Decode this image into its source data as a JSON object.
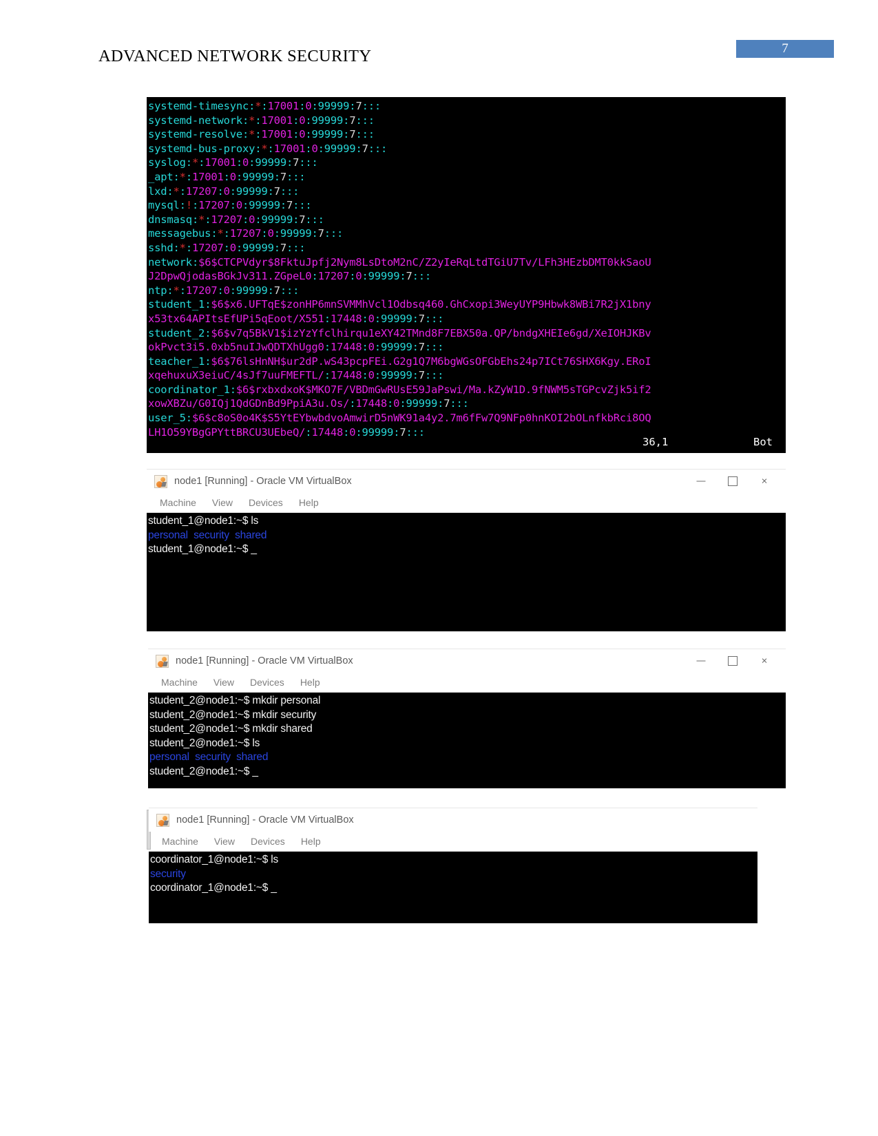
{
  "document": {
    "header_title": "ADVANCED NETWORK SECURITY",
    "page_number": "7",
    "accent_color": "#4f81bd"
  },
  "shadow_terminal": {
    "name": "etc-shadow-dump",
    "status_position": "36,1",
    "status_mode": "Bot",
    "lines": [
      [
        {
          "t": "systemd-timesync",
          "c": "cyan"
        },
        {
          "t": ":",
          "c": "cyan"
        },
        {
          "t": "*",
          "c": "red"
        },
        {
          "t": ":",
          "c": "cyan"
        },
        {
          "t": "17001",
          "c": "mag"
        },
        {
          "t": ":",
          "c": "cyan"
        },
        {
          "t": "0",
          "c": "mag"
        },
        {
          "t": ":",
          "c": "cyan"
        },
        {
          "t": "99999",
          "c": "cyan"
        },
        {
          "t": ":",
          "c": "cyan"
        },
        {
          "t": "7",
          "c": "white"
        },
        {
          "t": ":::",
          "c": "cyan"
        }
      ],
      [
        {
          "t": "systemd-network",
          "c": "cyan"
        },
        {
          "t": ":",
          "c": "cyan"
        },
        {
          "t": "*",
          "c": "red"
        },
        {
          "t": ":",
          "c": "cyan"
        },
        {
          "t": "17001",
          "c": "mag"
        },
        {
          "t": ":",
          "c": "cyan"
        },
        {
          "t": "0",
          "c": "mag"
        },
        {
          "t": ":",
          "c": "cyan"
        },
        {
          "t": "99999",
          "c": "cyan"
        },
        {
          "t": ":",
          "c": "cyan"
        },
        {
          "t": "7",
          "c": "white"
        },
        {
          "t": ":::",
          "c": "cyan"
        }
      ],
      [
        {
          "t": "systemd-resolve",
          "c": "cyan"
        },
        {
          "t": ":",
          "c": "cyan"
        },
        {
          "t": "*",
          "c": "red"
        },
        {
          "t": ":",
          "c": "cyan"
        },
        {
          "t": "17001",
          "c": "mag"
        },
        {
          "t": ":",
          "c": "cyan"
        },
        {
          "t": "0",
          "c": "mag"
        },
        {
          "t": ":",
          "c": "cyan"
        },
        {
          "t": "99999",
          "c": "cyan"
        },
        {
          "t": ":",
          "c": "cyan"
        },
        {
          "t": "7",
          "c": "white"
        },
        {
          "t": ":::",
          "c": "cyan"
        }
      ],
      [
        {
          "t": "systemd-bus-proxy",
          "c": "cyan"
        },
        {
          "t": ":",
          "c": "cyan"
        },
        {
          "t": "*",
          "c": "red"
        },
        {
          "t": ":",
          "c": "cyan"
        },
        {
          "t": "17001",
          "c": "mag"
        },
        {
          "t": ":",
          "c": "cyan"
        },
        {
          "t": "0",
          "c": "mag"
        },
        {
          "t": ":",
          "c": "cyan"
        },
        {
          "t": "99999",
          "c": "cyan"
        },
        {
          "t": ":",
          "c": "cyan"
        },
        {
          "t": "7",
          "c": "white"
        },
        {
          "t": ":::",
          "c": "cyan"
        }
      ],
      [
        {
          "t": "syslog",
          "c": "cyan"
        },
        {
          "t": ":",
          "c": "cyan"
        },
        {
          "t": "*",
          "c": "red"
        },
        {
          "t": ":",
          "c": "cyan"
        },
        {
          "t": "17001",
          "c": "mag"
        },
        {
          "t": ":",
          "c": "cyan"
        },
        {
          "t": "0",
          "c": "mag"
        },
        {
          "t": ":",
          "c": "cyan"
        },
        {
          "t": "99999",
          "c": "cyan"
        },
        {
          "t": ":",
          "c": "cyan"
        },
        {
          "t": "7",
          "c": "white"
        },
        {
          "t": ":::",
          "c": "cyan"
        }
      ],
      [
        {
          "t": "_apt",
          "c": "cyan"
        },
        {
          "t": ":",
          "c": "cyan"
        },
        {
          "t": "*",
          "c": "red"
        },
        {
          "t": ":",
          "c": "cyan"
        },
        {
          "t": "17001",
          "c": "mag"
        },
        {
          "t": ":",
          "c": "cyan"
        },
        {
          "t": "0",
          "c": "mag"
        },
        {
          "t": ":",
          "c": "cyan"
        },
        {
          "t": "99999",
          "c": "cyan"
        },
        {
          "t": ":",
          "c": "cyan"
        },
        {
          "t": "7",
          "c": "white"
        },
        {
          "t": ":::",
          "c": "cyan"
        }
      ],
      [
        {
          "t": "lxd",
          "c": "cyan"
        },
        {
          "t": ":",
          "c": "cyan"
        },
        {
          "t": "*",
          "c": "red"
        },
        {
          "t": ":",
          "c": "cyan"
        },
        {
          "t": "17207",
          "c": "mag"
        },
        {
          "t": ":",
          "c": "cyan"
        },
        {
          "t": "0",
          "c": "mag"
        },
        {
          "t": ":",
          "c": "cyan"
        },
        {
          "t": "99999",
          "c": "cyan"
        },
        {
          "t": ":",
          "c": "cyan"
        },
        {
          "t": "7",
          "c": "white"
        },
        {
          "t": ":::",
          "c": "cyan"
        }
      ],
      [
        {
          "t": "mysql",
          "c": "cyan"
        },
        {
          "t": ":",
          "c": "cyan"
        },
        {
          "t": "!",
          "c": "red"
        },
        {
          "t": ":",
          "c": "cyan"
        },
        {
          "t": "17207",
          "c": "mag"
        },
        {
          "t": ":",
          "c": "cyan"
        },
        {
          "t": "0",
          "c": "mag"
        },
        {
          "t": ":",
          "c": "cyan"
        },
        {
          "t": "99999",
          "c": "cyan"
        },
        {
          "t": ":",
          "c": "cyan"
        },
        {
          "t": "7",
          "c": "white"
        },
        {
          "t": ":::",
          "c": "cyan"
        }
      ],
      [
        {
          "t": "dnsmasq",
          "c": "cyan"
        },
        {
          "t": ":",
          "c": "cyan"
        },
        {
          "t": "*",
          "c": "red"
        },
        {
          "t": ":",
          "c": "cyan"
        },
        {
          "t": "17207",
          "c": "mag"
        },
        {
          "t": ":",
          "c": "cyan"
        },
        {
          "t": "0",
          "c": "mag"
        },
        {
          "t": ":",
          "c": "cyan"
        },
        {
          "t": "99999",
          "c": "cyan"
        },
        {
          "t": ":",
          "c": "cyan"
        },
        {
          "t": "7",
          "c": "white"
        },
        {
          "t": ":::",
          "c": "cyan"
        }
      ],
      [
        {
          "t": "messagebus",
          "c": "cyan"
        },
        {
          "t": ":",
          "c": "cyan"
        },
        {
          "t": "*",
          "c": "red"
        },
        {
          "t": ":",
          "c": "cyan"
        },
        {
          "t": "17207",
          "c": "mag"
        },
        {
          "t": ":",
          "c": "cyan"
        },
        {
          "t": "0",
          "c": "mag"
        },
        {
          "t": ":",
          "c": "cyan"
        },
        {
          "t": "99999",
          "c": "cyan"
        },
        {
          "t": ":",
          "c": "cyan"
        },
        {
          "t": "7",
          "c": "white"
        },
        {
          "t": ":::",
          "c": "cyan"
        }
      ],
      [
        {
          "t": "sshd",
          "c": "cyan"
        },
        {
          "t": ":",
          "c": "cyan"
        },
        {
          "t": "*",
          "c": "red"
        },
        {
          "t": ":",
          "c": "cyan"
        },
        {
          "t": "17207",
          "c": "mag"
        },
        {
          "t": ":",
          "c": "cyan"
        },
        {
          "t": "0",
          "c": "mag"
        },
        {
          "t": ":",
          "c": "cyan"
        },
        {
          "t": "99999",
          "c": "cyan"
        },
        {
          "t": ":",
          "c": "cyan"
        },
        {
          "t": "7",
          "c": "white"
        },
        {
          "t": ":::",
          "c": "cyan"
        }
      ],
      [
        {
          "t": "network",
          "c": "cyan"
        },
        {
          "t": ":",
          "c": "cyan"
        },
        {
          "t": "$6$CTCPVdyr$8FktuJpfj2Nym8LsDtoM2nC/Z2yIeRqLtdTGiU7Tv/LFh3HEzbDMT0kkSaoU",
          "c": "mag"
        }
      ],
      [
        {
          "t": "J2DpwQjodasBGkJv311.ZGpeL0",
          "c": "mag"
        },
        {
          "t": ":",
          "c": "cyan"
        },
        {
          "t": "17207",
          "c": "mag"
        },
        {
          "t": ":",
          "c": "cyan"
        },
        {
          "t": "0",
          "c": "mag"
        },
        {
          "t": ":",
          "c": "cyan"
        },
        {
          "t": "99999",
          "c": "cyan"
        },
        {
          "t": ":",
          "c": "cyan"
        },
        {
          "t": "7",
          "c": "white"
        },
        {
          "t": ":::",
          "c": "cyan"
        }
      ],
      [
        {
          "t": "ntp",
          "c": "cyan"
        },
        {
          "t": ":",
          "c": "cyan"
        },
        {
          "t": "*",
          "c": "red"
        },
        {
          "t": ":",
          "c": "cyan"
        },
        {
          "t": "17207",
          "c": "mag"
        },
        {
          "t": ":",
          "c": "cyan"
        },
        {
          "t": "0",
          "c": "mag"
        },
        {
          "t": ":",
          "c": "cyan"
        },
        {
          "t": "99999",
          "c": "cyan"
        },
        {
          "t": ":",
          "c": "cyan"
        },
        {
          "t": "7",
          "c": "white"
        },
        {
          "t": ":::",
          "c": "cyan"
        }
      ],
      [
        {
          "t": "student_1",
          "c": "cyan"
        },
        {
          "t": ":",
          "c": "cyan"
        },
        {
          "t": "$6$x6.UFTqE$zonHP6mnSVMMhVcl1Odbsq460.GhCxopi3WeyUYP9Hbwk8WBi7R2jX1bny",
          "c": "mag"
        }
      ],
      [
        {
          "t": "x53tx64APItsEfUPi5qEoot/X551",
          "c": "mag"
        },
        {
          "t": ":",
          "c": "cyan"
        },
        {
          "t": "17448",
          "c": "mag"
        },
        {
          "t": ":",
          "c": "cyan"
        },
        {
          "t": "0",
          "c": "mag"
        },
        {
          "t": ":",
          "c": "cyan"
        },
        {
          "t": "99999",
          "c": "cyan"
        },
        {
          "t": ":",
          "c": "cyan"
        },
        {
          "t": "7",
          "c": "white"
        },
        {
          "t": ":::",
          "c": "cyan"
        }
      ],
      [
        {
          "t": "student_2",
          "c": "cyan"
        },
        {
          "t": ":",
          "c": "cyan"
        },
        {
          "t": "$6$v7q5BkV1$izYzYfclhirqu1eXY42TMnd8F7EBX50a.QP/bndgXHEIe6gd/XeIOHJKBv",
          "c": "mag"
        }
      ],
      [
        {
          "t": "okPvct3i5.0xb5nuIJwQDTXhUgg0",
          "c": "mag"
        },
        {
          "t": ":",
          "c": "cyan"
        },
        {
          "t": "17448",
          "c": "mag"
        },
        {
          "t": ":",
          "c": "cyan"
        },
        {
          "t": "0",
          "c": "mag"
        },
        {
          "t": ":",
          "c": "cyan"
        },
        {
          "t": "99999",
          "c": "cyan"
        },
        {
          "t": ":",
          "c": "cyan"
        },
        {
          "t": "7",
          "c": "white"
        },
        {
          "t": ":::",
          "c": "cyan"
        }
      ],
      [
        {
          "t": "teacher_1",
          "c": "cyan"
        },
        {
          "t": ":",
          "c": "cyan"
        },
        {
          "t": "$6$76lsHnNH$ur2dP.wS43pcpFEi.G2g1Q7M6bgWGsOFGbEhs24p7ICt76SHX6Kgy.ERoI",
          "c": "mag"
        }
      ],
      [
        {
          "t": "xqehuxuX3eiuC/4sJf7uuFMEFTL/",
          "c": "mag"
        },
        {
          "t": ":",
          "c": "cyan"
        },
        {
          "t": "17448",
          "c": "mag"
        },
        {
          "t": ":",
          "c": "cyan"
        },
        {
          "t": "0",
          "c": "mag"
        },
        {
          "t": ":",
          "c": "cyan"
        },
        {
          "t": "99999",
          "c": "cyan"
        },
        {
          "t": ":",
          "c": "cyan"
        },
        {
          "t": "7",
          "c": "white"
        },
        {
          "t": ":::",
          "c": "cyan"
        }
      ],
      [
        {
          "t": "coordinator_1",
          "c": "cyan"
        },
        {
          "t": ":",
          "c": "cyan"
        },
        {
          "t": "$6$rxbxdxoK$MKO7F/VBDmGwRUsE59JaPswi/Ma.kZyW1D.9fNWM5sTGPcvZjk5if2",
          "c": "mag"
        }
      ],
      [
        {
          "t": "xowXBZu/G0IQj1QdGDnBd9PpiA3u.Os/",
          "c": "mag"
        },
        {
          "t": ":",
          "c": "cyan"
        },
        {
          "t": "17448",
          "c": "mag"
        },
        {
          "t": ":",
          "c": "cyan"
        },
        {
          "t": "0",
          "c": "mag"
        },
        {
          "t": ":",
          "c": "cyan"
        },
        {
          "t": "99999",
          "c": "cyan"
        },
        {
          "t": ":",
          "c": "cyan"
        },
        {
          "t": "7",
          "c": "white"
        },
        {
          "t": ":::",
          "c": "cyan"
        }
      ],
      [
        {
          "t": "user_5",
          "c": "cyan"
        },
        {
          "t": ":",
          "c": "cyan"
        },
        {
          "t": "$6$c8oS0o4K$S5YtEYbwbdvoAmwirD5nWK91a4y2.7m6fFw7Q9NFp0hnKOI2bOLnfkbRci8OQ",
          "c": "mag"
        }
      ],
      [
        {
          "t": "LH1O59YBgGPYttBRCU3UEbeQ/",
          "c": "mag"
        },
        {
          "t": ":",
          "c": "cyan"
        },
        {
          "t": "17448",
          "c": "mag"
        },
        {
          "t": ":",
          "c": "cyan"
        },
        {
          "t": "0",
          "c": "mag"
        },
        {
          "t": ":",
          "c": "cyan"
        },
        {
          "t": "99999",
          "c": "cyan"
        },
        {
          "t": ":",
          "c": "cyan"
        },
        {
          "t": "7",
          "c": "white"
        },
        {
          "t": ":::",
          "c": "cyan"
        }
      ]
    ]
  },
  "vbox_common": {
    "title": "node1 [Running] - Oracle VM VirtualBox",
    "menu": [
      "Machine",
      "View",
      "Devices",
      "Help"
    ],
    "controls": {
      "minimize": "—",
      "maximize": "□",
      "close": "×"
    }
  },
  "vbox_windows": [
    {
      "id": "vbox1",
      "lines": [
        [
          {
            "t": "student_1@node1:~$ ls",
            "c": "bold-w"
          }
        ],
        [
          {
            "t": "personal  security  shared",
            "c": "blue"
          }
        ],
        [
          {
            "t": "student_1@node1:~$ ",
            "c": "bold-w"
          },
          {
            "t": "_",
            "c": "bold-w"
          }
        ]
      ]
    },
    {
      "id": "vbox2",
      "lines": [
        [
          {
            "t": "student_2@node1:~$ mkdir personal",
            "c": "bold-w"
          }
        ],
        [
          {
            "t": "student_2@node1:~$ mkdir security",
            "c": "bold-w"
          }
        ],
        [
          {
            "t": "student_2@node1:~$ mkdir shared",
            "c": "bold-w"
          }
        ],
        [
          {
            "t": "student_2@node1:~$ ls",
            "c": "bold-w"
          }
        ],
        [
          {
            "t": "personal  security  shared",
            "c": "blue"
          }
        ],
        [
          {
            "t": "student_2@node1:~$ ",
            "c": "bold-w"
          },
          {
            "t": "_",
            "c": "bold-w"
          }
        ]
      ]
    },
    {
      "id": "vbox3",
      "lines": [
        [
          {
            "t": "coordinator_1@node1:~$ ls",
            "c": "bold-w"
          }
        ],
        [
          {
            "t": "security",
            "c": "blue"
          }
        ],
        [
          {
            "t": "coordinator_1@node1:~$ ",
            "c": "bold-w"
          },
          {
            "t": "_",
            "c": "bold-w"
          }
        ]
      ]
    }
  ]
}
